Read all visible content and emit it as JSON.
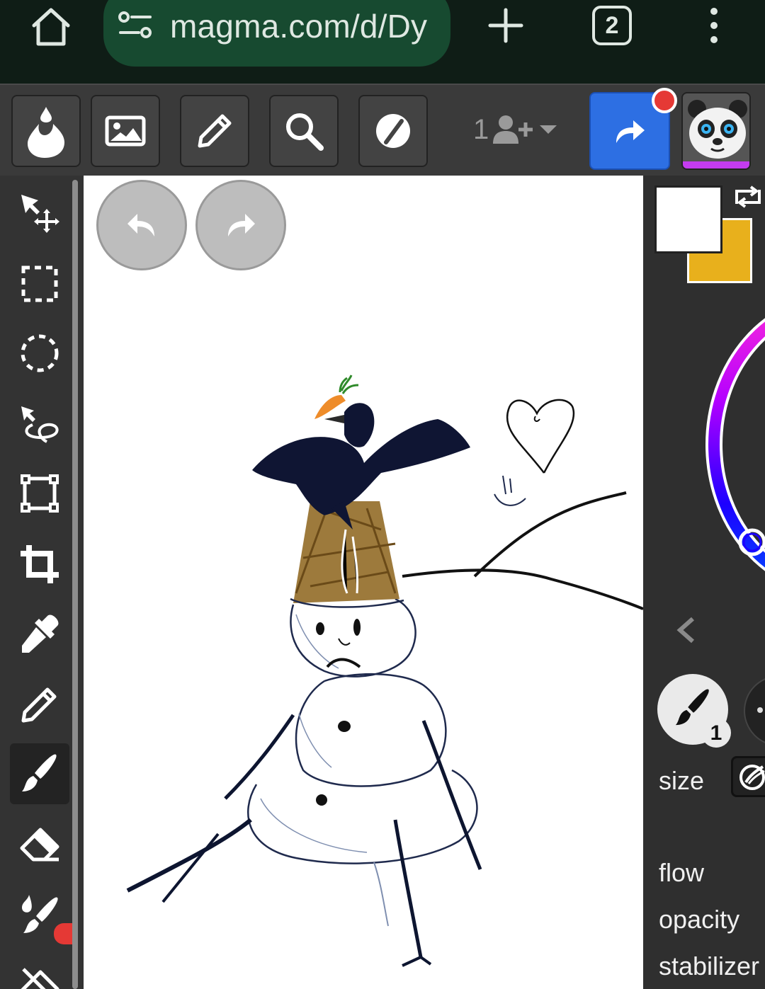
{
  "browser": {
    "url": "magma.com/d/Dy",
    "tab_count": "2"
  },
  "toolbar": {
    "collaborator_count": "1",
    "tools": [
      "drop-icon",
      "image-icon",
      "pencil-icon",
      "search-icon",
      "circle-slash-icon"
    ]
  },
  "canvas": {
    "undo_icon": "undo-icon",
    "redo_icon": "redo-icon"
  },
  "side_tools": [
    "move-icon",
    "rect-select-icon",
    "ellipse-select-icon",
    "lasso-icon",
    "transform-icon",
    "crop-icon",
    "eyedropper-icon",
    "pencil-icon",
    "brush-icon",
    "eraser-icon",
    "smudge-icon",
    "fill-eraser-icon"
  ],
  "colors": {
    "primary": "#ffffff",
    "secondary": "#e8b01c",
    "accent": "#2d6fe3",
    "notification": "#e53935"
  },
  "brush_panel": {
    "brush_number": "1",
    "size_label": "size",
    "flow_label": "flow",
    "opacity_label": "opacity",
    "stabilizer_label": "stabilizer"
  }
}
